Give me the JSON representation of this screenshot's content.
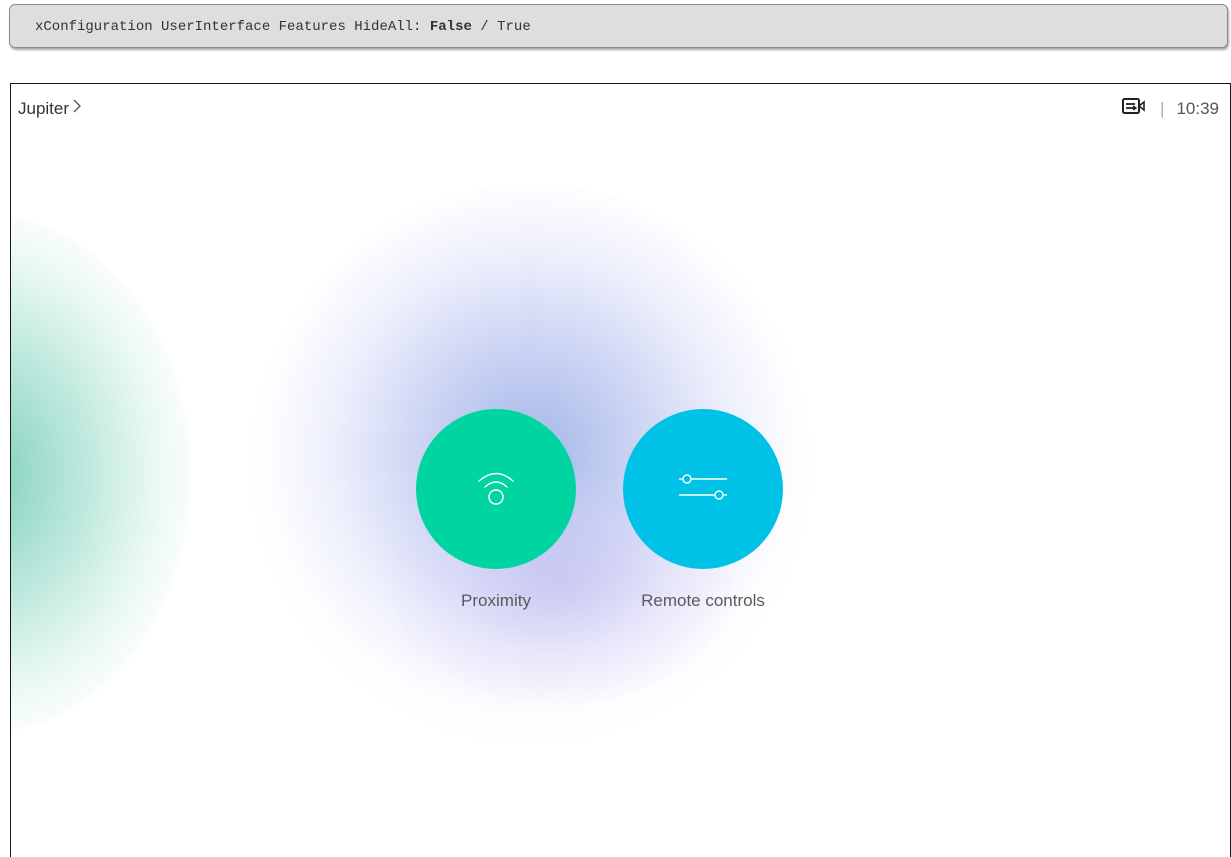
{
  "code_bar": {
    "prefix": "xConfiguration UserInterface Features HideAll: ",
    "selected_value": "False",
    "separator": " / ",
    "other_value": "True"
  },
  "header": {
    "room_name": "Jupiter",
    "time": "10:39",
    "separator": "|",
    "status_icon": "camera-display-icon"
  },
  "tiles": [
    {
      "label": "Proximity",
      "icon": "proximity-wifi-icon",
      "color": "#00d4a0"
    },
    {
      "label": "Remote controls",
      "icon": "sliders-icon",
      "color": "#00c2e6"
    }
  ]
}
